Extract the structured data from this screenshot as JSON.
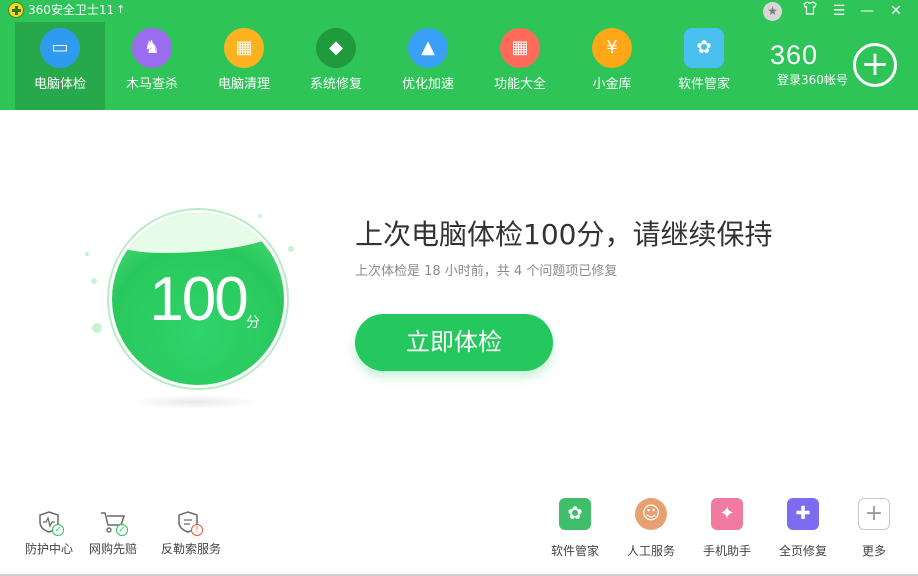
{
  "titlebar": {
    "app_title": "360安全卫士11",
    "upgrade_icon": "↑",
    "star_icon": "★",
    "skin_icon": "👕",
    "menu_icon": "☰",
    "minimize_icon": "—",
    "close_icon": "✕"
  },
  "nav": {
    "items": [
      {
        "label": "电脑体检",
        "icon": "monitor-icon",
        "glyph": "▭",
        "color": "#2f9bf0",
        "active": true
      },
      {
        "label": "木马查杀",
        "icon": "horse-icon",
        "glyph": "♞",
        "color": "#9b6cf0",
        "active": false
      },
      {
        "label": "电脑清理",
        "icon": "broom-icon",
        "glyph": "▦",
        "color": "#ffb21f",
        "active": false
      },
      {
        "label": "系统修复",
        "icon": "shield-icon",
        "glyph": "◆",
        "color": "#1f9a3d",
        "active": false
      },
      {
        "label": "优化加速",
        "icon": "rocket-icon",
        "glyph": "▲",
        "color": "#3aa0f5",
        "active": false
      },
      {
        "label": "功能大全",
        "icon": "grid-icon",
        "glyph": "▦",
        "color": "#ff6a5a",
        "active": false
      },
      {
        "label": "小金库",
        "icon": "money-bag-icon",
        "glyph": "¥",
        "color": "#ffa716",
        "active": false
      },
      {
        "label": "软件管家",
        "icon": "app-store-icon",
        "glyph": "✿",
        "color": "#4ac0f0",
        "active": false
      }
    ]
  },
  "account": {
    "brand": "360",
    "login_label": "登录360帐号",
    "plus_icon": "+"
  },
  "score": {
    "value": "100",
    "unit": "分"
  },
  "main": {
    "headline": "上次电脑体检100分，请继续保持",
    "subline": "上次体检是 18 小时前，共 4 个问题项已修复",
    "check_button": "立即体检"
  },
  "bottom_left": [
    {
      "label": "防护中心",
      "icon": "protection-center-icon",
      "glyph": "♡",
      "badge": "✓",
      "badge_color": "#2ec458"
    },
    {
      "label": "网购先赔",
      "icon": "shopping-cart-icon",
      "glyph": "🛒",
      "badge": "✓",
      "badge_color": "#2ec458"
    },
    {
      "label": "反勒索服务",
      "icon": "anti-ransom-shield-icon",
      "glyph": "⛨",
      "badge": "!",
      "badge_color": "#f05a3a"
    }
  ],
  "bottom_right": [
    {
      "label": "软件管家",
      "icon": "software-manager-icon",
      "glyph": "✿",
      "color": "#3fbf6a"
    },
    {
      "label": "人工服务",
      "icon": "customer-service-icon",
      "glyph": "☺",
      "color": "#e8a070"
    },
    {
      "label": "手机助手",
      "icon": "phone-assistant-icon",
      "glyph": "✦",
      "color": "#f07aa0"
    },
    {
      "label": "全页修复",
      "icon": "repair-icon",
      "glyph": "✚",
      "color": "#7d6cf0"
    },
    {
      "label": "更多",
      "icon": "more-icon",
      "glyph": "+",
      "color": "#c8c8c8"
    }
  ]
}
